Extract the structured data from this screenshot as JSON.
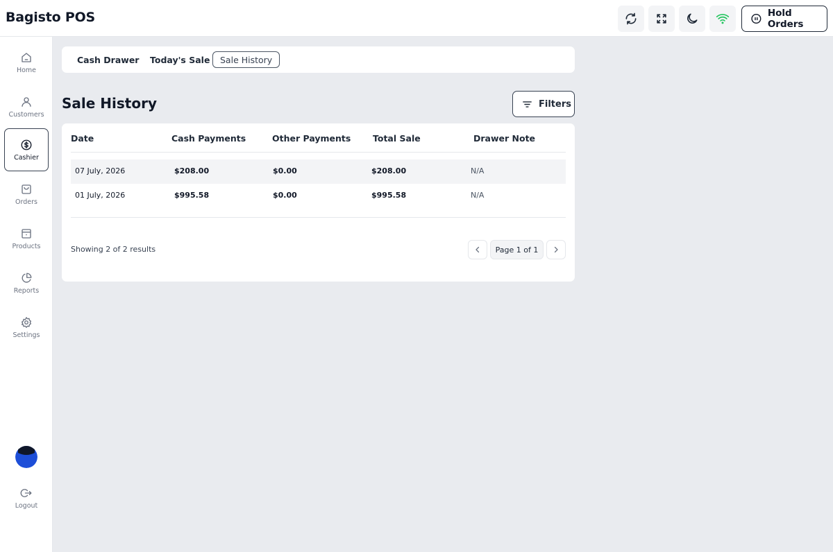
{
  "app": {
    "title": "Bagisto POS"
  },
  "header": {
    "hold_orders_label": "Hold Orders",
    "icons": [
      "refresh-icon",
      "fullscreen-icon",
      "moon-icon",
      "wifi-icon",
      "pause-icon"
    ],
    "wifi_color": "#22c55e"
  },
  "sidebar": {
    "items": [
      {
        "label": "Home",
        "icon": "home-icon"
      },
      {
        "label": "Customers",
        "icon": "user-icon"
      },
      {
        "label": "Cashier",
        "icon": "dollar-circle-icon",
        "active": true
      },
      {
        "label": "Orders",
        "icon": "shopping-bag-icon"
      },
      {
        "label": "Products",
        "icon": "box-icon"
      },
      {
        "label": "Reports",
        "icon": "pie-chart-icon"
      },
      {
        "label": "Settings",
        "icon": "gear-icon"
      }
    ],
    "logout_label": "Logout",
    "avatar_color": "#1d4ed8"
  },
  "tabs": [
    {
      "label": "Cash Drawer"
    },
    {
      "label": "Today's Sale"
    },
    {
      "label": "Sale History",
      "active": true
    }
  ],
  "main": {
    "title": "Sale History",
    "filters_label": "Filters",
    "columns": [
      "Date",
      "Cash Payments",
      "Other Payments",
      "Total Sale",
      "Drawer Note"
    ],
    "rows": [
      {
        "date": "07 July, 2026",
        "cash": "$208.00",
        "other": "$0.00",
        "total": "$208.00",
        "note": "N/A"
      },
      {
        "date": "01 July, 2026",
        "cash": "$995.58",
        "other": "$0.00",
        "total": "$995.58",
        "note": "N/A"
      }
    ],
    "showing": "Showing 2 of 2 results",
    "page_label": "Page 1 of 1"
  }
}
